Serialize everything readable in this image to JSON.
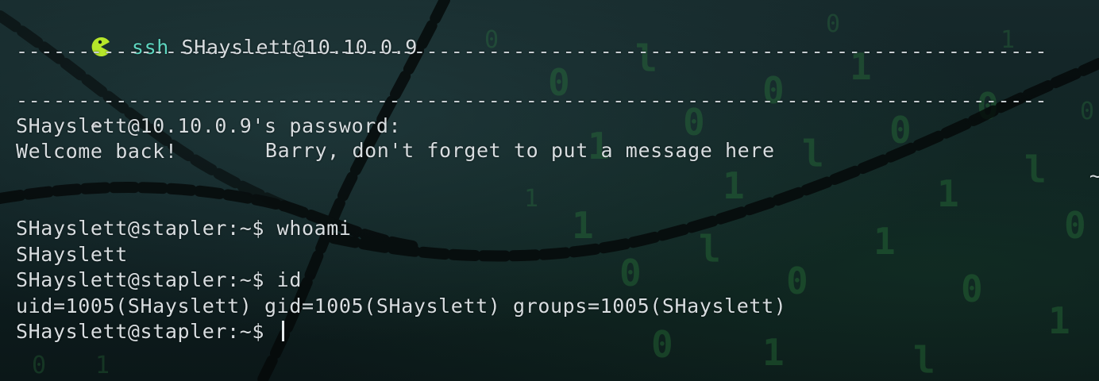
{
  "terminal": {
    "ssh_command": "ssh",
    "ssh_target": "SHayslett@10.10.0.9",
    "separator": "------------------------------------------------------------------------------------------------------------",
    "banner": {
      "tilde_left": "~",
      "message": "Barry, don't forget to put a message here",
      "tilde_right": "~"
    },
    "password_prompt": "SHayslett@10.10.0.9's password:",
    "welcome": "Welcome back!",
    "prompt_1": "SHayslett@stapler:~$ whoami",
    "output_1": "SHayslett",
    "prompt_2": "SHayslett@stapler:~$ id",
    "output_2": "uid=1005(SHayslett) gid=1005(SHayslett) groups=1005(SHayslett)",
    "prompt_3": "SHayslett@stapler:~$ "
  },
  "icons": {
    "prompt_icon": "pacman-icon"
  },
  "colors": {
    "prompt_icon": "#b6e62a",
    "ssh_command": "#5ed6c0",
    "text": "#d8dde0"
  }
}
